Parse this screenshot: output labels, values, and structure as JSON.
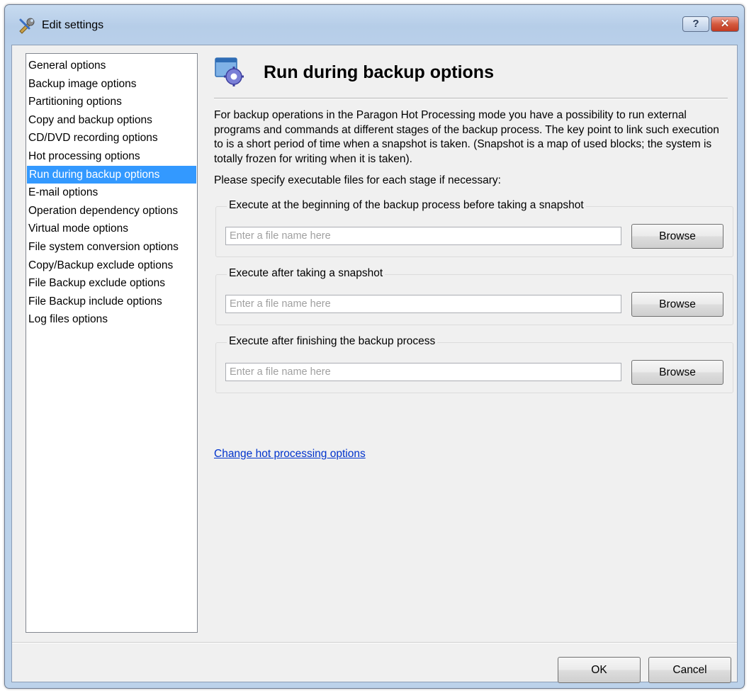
{
  "window": {
    "title": "Edit settings",
    "help_symbol": "?",
    "close_symbol": "✕",
    "icon": "wrench-screwdriver-icon"
  },
  "sidebar": {
    "selected_index": 6,
    "items": [
      {
        "label": "General options"
      },
      {
        "label": "Backup image options"
      },
      {
        "label": "Partitioning options"
      },
      {
        "label": "Copy and backup options"
      },
      {
        "label": "CD/DVD recording options"
      },
      {
        "label": "Hot processing options"
      },
      {
        "label": "Run during backup options"
      },
      {
        "label": "E-mail options"
      },
      {
        "label": "Operation dependency options"
      },
      {
        "label": "Virtual mode options"
      },
      {
        "label": "File system conversion options"
      },
      {
        "label": "Copy/Backup exclude options"
      },
      {
        "label": "File Backup exclude options"
      },
      {
        "label": "File Backup include options"
      },
      {
        "label": "Log files options"
      }
    ]
  },
  "main": {
    "header_icon": "window-gear-icon",
    "title": "Run during backup options",
    "description": "For backup operations in the Paragon Hot Processing mode you have a possibility to run external programs and commands at different stages of the backup process. The key point to link such execution to is a short period of time when a snapshot is taken. (Snapshot is a map of used blocks; the system is totally frozen for writing when it is taken).",
    "prompt": "Please specify executable files for each stage if necessary:",
    "groups": [
      {
        "label": "Execute at the beginning of the backup process before taking a snapshot",
        "value": "",
        "placeholder": "Enter a file name here",
        "browse_label": "Browse"
      },
      {
        "label": "Execute after taking a snapshot",
        "value": "",
        "placeholder": "Enter a file name here",
        "browse_label": "Browse"
      },
      {
        "label": "Execute after finishing the backup process",
        "value": "",
        "placeholder": "Enter a file name here",
        "browse_label": "Browse"
      }
    ],
    "link": "Change hot processing options"
  },
  "footer": {
    "ok_label": "OK",
    "cancel_label": "Cancel"
  },
  "colors": {
    "selection": "#3399ff",
    "link": "#0033cc",
    "close_button": "#c94a2e"
  }
}
